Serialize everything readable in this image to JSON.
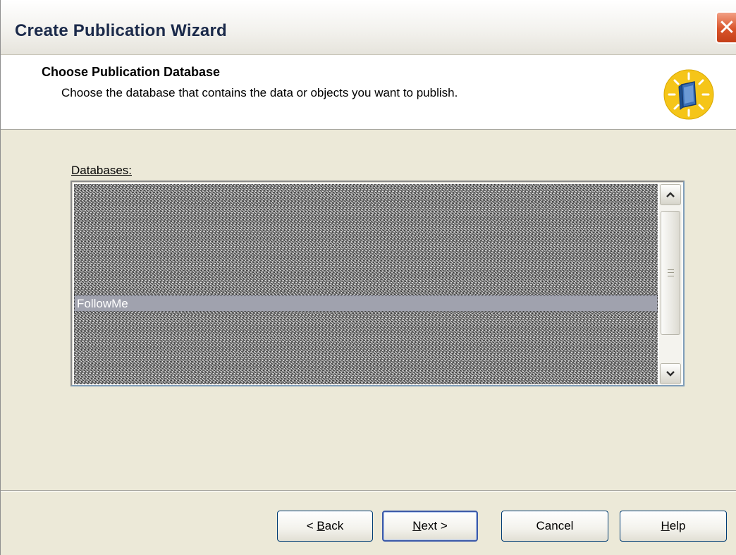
{
  "window": {
    "title": "Create Publication Wizard",
    "close_glyph": "✕"
  },
  "header": {
    "title": "Choose Publication Database",
    "subtitle": "Choose the database that contains the data or objects you want to publish.",
    "icon": "wizard-book-icon"
  },
  "databases": {
    "label": "Databases:",
    "selected_item": "FollowMe"
  },
  "scrollbar": {
    "up_icon": "scroll-up-arrow-icon",
    "down_icon": "scroll-down-arrow-icon"
  },
  "buttons": {
    "back": {
      "prefix": "< ",
      "mnemonic": "B",
      "rest": "ack"
    },
    "next": {
      "mnemonic": "N",
      "rest": "ext >"
    },
    "cancel": {
      "label": "Cancel"
    },
    "help": {
      "mnemonic": "H",
      "rest": "elp"
    }
  },
  "colors": {
    "accent_border": "#3c5aa8",
    "selection": "#a0a2ae",
    "close_red": "#d9542a",
    "icon_gold": "#f5c518"
  }
}
